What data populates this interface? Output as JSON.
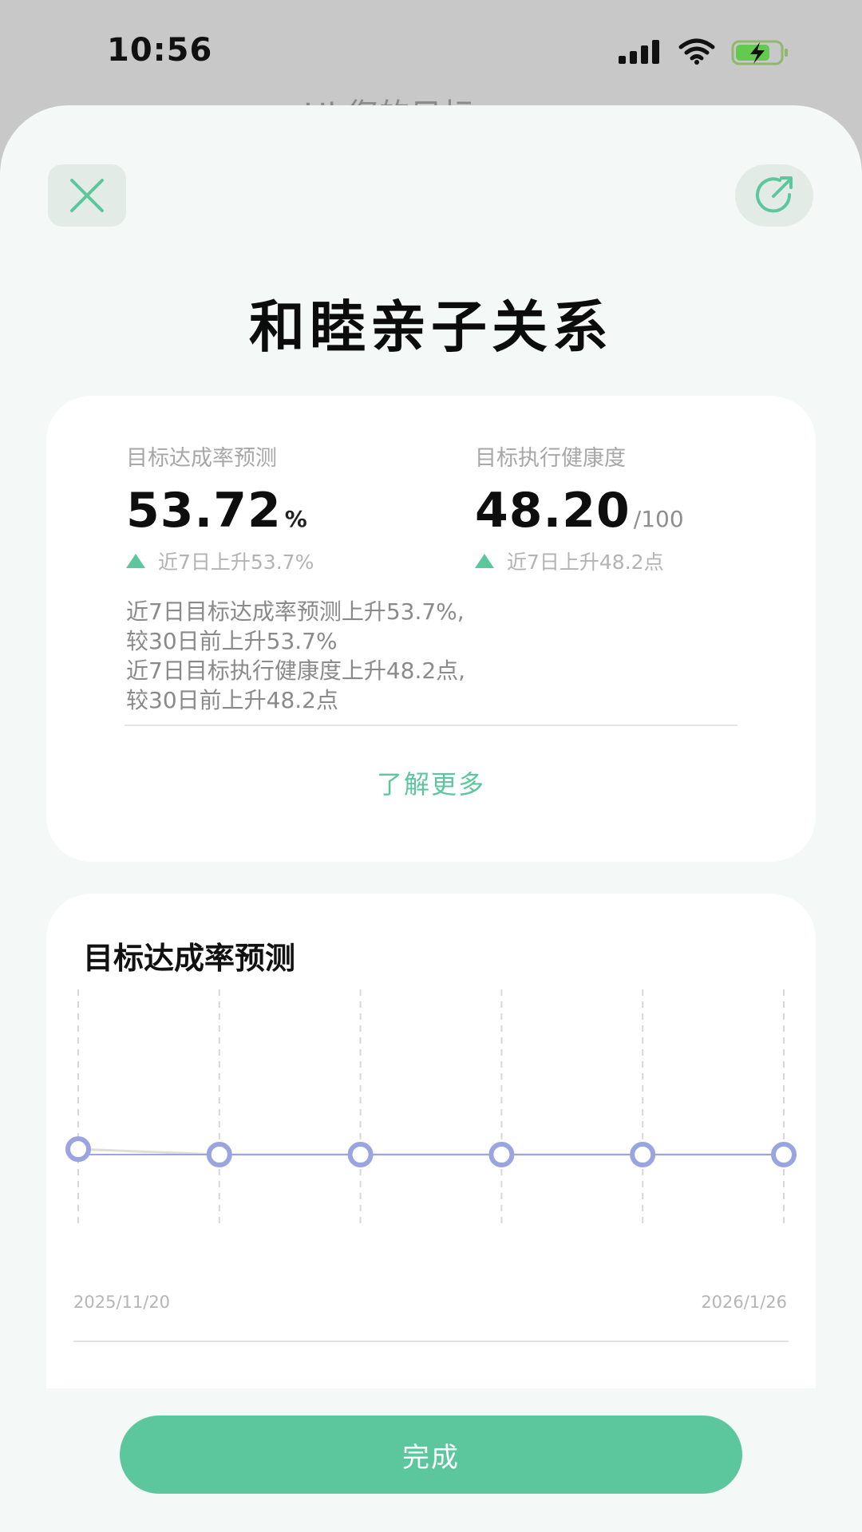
{
  "status_bar": {
    "time": "10:56",
    "icons": [
      "signal-icon",
      "wifi-icon",
      "battery-charging-icon"
    ]
  },
  "background_page": {
    "title_partial": "Hi 您的目标"
  },
  "sheet": {
    "close_icon": "close-icon",
    "share_icon": "share-icon",
    "title": "和睦亲子关系"
  },
  "summary": {
    "metrics": [
      {
        "label": "目标达成率预测",
        "value": "53.72",
        "unit": "%",
        "trend": "近7日上升53.7%"
      },
      {
        "label": "目标执行健康度",
        "value": "48.20",
        "unit": "/100",
        "trend": "近7日上升48.2点"
      }
    ],
    "description": [
      "近7日目标达成率预测上升53.7%,",
      "较30日前上升53.7%",
      "近7日目标执行健康度上升48.2点,",
      "较30日前上升48.2点"
    ],
    "learn_more": "了解更多"
  },
  "chart": {
    "title": "目标达成率预测",
    "x_start_label": "2025/11/20",
    "x_end_label": "2026/1/26"
  },
  "chart_data": {
    "type": "line",
    "title": "目标达成率预测",
    "x_start": "2025/11/20",
    "x_end": "2026/1/26",
    "point_count": 6,
    "series": [
      {
        "values": [
          55,
          53.7,
          53.7,
          53.7,
          53.7,
          53.7
        ]
      }
    ],
    "ylim": [
      0,
      100
    ],
    "grid": "vertical-dashed",
    "colors": {
      "line": "#9ca6dc",
      "point_stroke": "#9aa4e0",
      "previous_line": "#dddddd"
    }
  },
  "footer": {
    "done_label": "完成"
  },
  "colors": {
    "accent": "#5cc79c",
    "sheet_bg": "#f4f8f6",
    "card_bg": "#ffffff"
  }
}
